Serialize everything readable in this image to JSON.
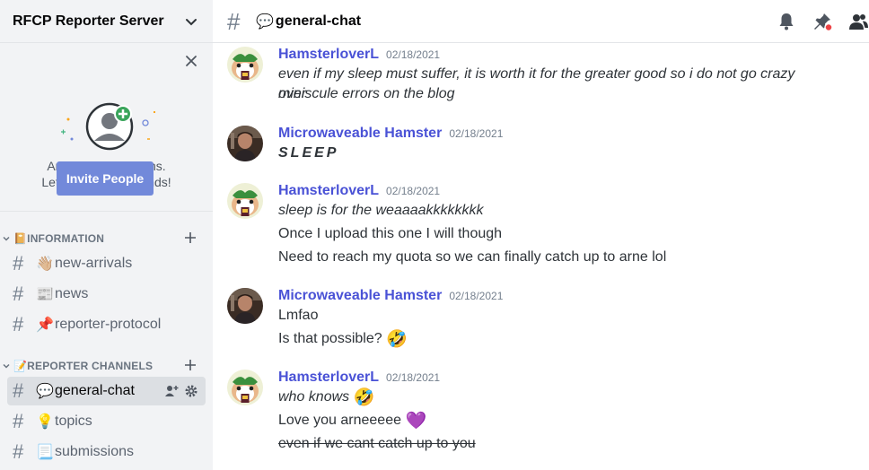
{
  "server": {
    "name": "RFCP Reporter Server"
  },
  "invite": {
    "line1": "An adventure begins.",
    "line2": "Let's add some friends!",
    "button": "Invite People"
  },
  "categories": [
    {
      "label": "INFORMATION",
      "emoji": "📔"
    },
    {
      "label": "REPORTER CHANNELS",
      "emoji": "📝"
    }
  ],
  "channels": [
    {
      "emoji": "👋🏼",
      "name": "new-arrivals"
    },
    {
      "emoji": "📰",
      "name": "news"
    },
    {
      "emoji": "📌",
      "name": "reporter-protocol"
    },
    {
      "emoji": "💬",
      "name": "general-chat"
    },
    {
      "emoji": "💡",
      "name": "topics"
    },
    {
      "emoji": "📃",
      "name": "submissions"
    }
  ],
  "topbar": {
    "emoji": "💬",
    "channel": "general-chat"
  },
  "messages": [
    {
      "author": "HamsterloverL",
      "time": "02/18/2021",
      "lines": [
        "even if my sleep must suffer, it is worth it for the greater good so i do not go crazy over",
        "miniscule errors on the blog"
      ]
    },
    {
      "author": "Microwaveable Hamster",
      "time": "02/18/2021",
      "lines": [
        "SLEEP"
      ]
    },
    {
      "author": "HamsterloverL",
      "time": "02/18/2021",
      "lines": [
        "sleep is for the weaaaakkkkkkkk",
        "Once I upload this one I will though",
        "Need to reach my quota so we can finally catch up to arne lol"
      ]
    },
    {
      "author": "Microwaveable Hamster",
      "time": "02/18/2021",
      "lines": [
        "Lmfao",
        "Is that possible?"
      ],
      "emoji": "🤣"
    },
    {
      "author": "HamsterloverL",
      "time": "02/18/2021",
      "lines": [
        "who knows",
        "Love you arneeeee",
        "even if we cant catch up to you"
      ],
      "emoji1": "🤣",
      "emoji2": "💜"
    }
  ],
  "colors": {
    "accent": "#7289da",
    "author": "#4a52d6",
    "sidebar": "#f2f3f5"
  }
}
